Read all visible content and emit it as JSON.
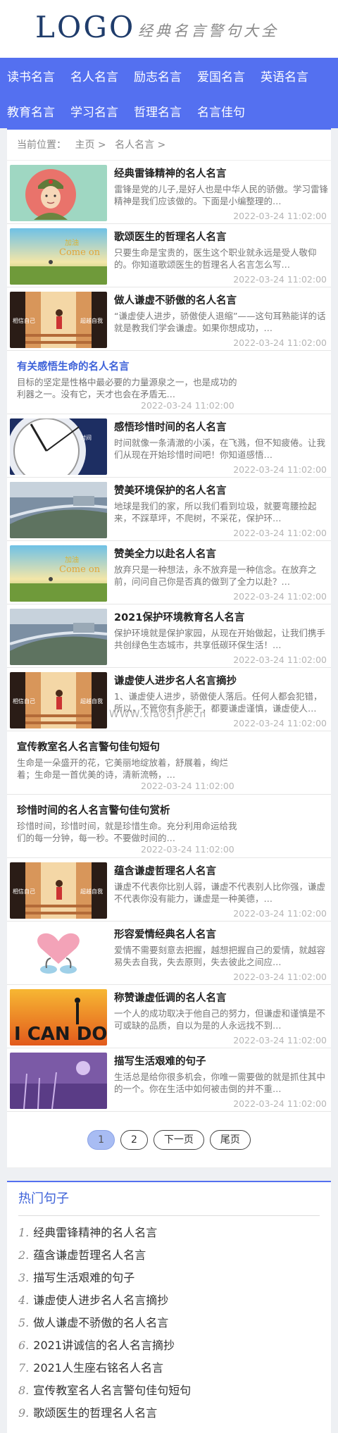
{
  "header": {
    "logo": "LOGO",
    "slogan": "经典名言警句大全"
  },
  "nav": {
    "row1": [
      "读书名言",
      "名人名言",
      "励志名言",
      "爱国名言",
      "英语名言"
    ],
    "row2": [
      "教育名言",
      "学习名言",
      "哲理名言",
      "名言佳句"
    ]
  },
  "breadcrumb": {
    "label": "当前位置：",
    "home": "主页 >",
    "section": "名人名言 >"
  },
  "items": [
    {
      "type": "img",
      "thumb": "soldier",
      "title": "经典雷锋精神的名人名言",
      "desc": "雷锋是党的儿子,是好人也是中华人民的骄傲。学习雷锋精神是我们应该做的。下面是小编整理的…",
      "time": "2022-03-24 11:02:00"
    },
    {
      "type": "img",
      "thumb": "field",
      "title": "歌颂医生的哲理名人名言",
      "desc": "只要生命是宝贵的，医生这个职业就永远是受人敬仰的。你知道歌颂医生的哲理名人名言怎么写…",
      "time": "2022-03-24 11:02:00"
    },
    {
      "type": "img",
      "thumb": "stairs",
      "title": "做人谦虚不骄傲的名人名言",
      "desc": "“谦虚使人进步，骄傲使人退缩”——这句耳熟能详的话就是教我们学会谦虚。如果你想成功，…",
      "time": "2022-03-24 11:02:00"
    },
    {
      "type": "text",
      "blue": true,
      "title": "有关感悟生命的名人名言",
      "desc": "目标的坚定是性格中最必要的力量源泉之一，也是成功的利器之一。没有它，天才也会在矛盾无…",
      "time": "2022-03-24 11:02:00"
    },
    {
      "type": "img",
      "thumb": "clock",
      "title": "感悟珍惜时间的名人名言",
      "desc": "时间就像一条清澈的小溪，在飞溅，但不知疲倦。让我们从现在开始珍惜时间吧！你知道感悟…",
      "time": "2022-03-24 11:02:00"
    },
    {
      "type": "img",
      "thumb": "aerial",
      "title": "赞美环境保护的名人名言",
      "desc": "地球是我们的家，所以我们看到垃圾，就要弯腰捡起来，不踩草坪，不爬树，不采花，保护环…",
      "time": "2022-03-24 11:02:00"
    },
    {
      "type": "img",
      "thumb": "field",
      "title": "赞美全力以赴名人名言",
      "desc": "放弃只是一种想法，永不放弃是一种信念。在放弃之前，问问自己你是否真的做到了全力以赴？…",
      "time": "2022-03-24 11:02:00"
    },
    {
      "type": "img",
      "thumb": "aerial",
      "title": "2021保护环境教育名人名言",
      "desc": "保护环境就是保护家园，从现在开始做起，让我们携手共创绿色生态城市，共享低碳环保生活！…",
      "time": "2022-03-24 11:02:00"
    },
    {
      "type": "img",
      "thumb": "stairs",
      "title": "谦虚使人进步名人名言摘抄",
      "desc": "1、谦虚使人进步，骄傲使人落后。任何人都会犯错，所以，不管你有多能干，都要谦虚谨慎，谦虚使人…",
      "time": "2022-03-24 11:02:00"
    },
    {
      "type": "text",
      "blue": false,
      "title": "宣传教室名人名言警句佳句短句",
      "desc": "生命是一朵盛开的花，它美丽地绽放着，舒展着，绚烂着；生命是一首优美的诗，清新流畅，…",
      "time": "2022-03-24 11:02:00"
    },
    {
      "type": "text",
      "blue": false,
      "title": "珍惜时间的名人名言警句佳句赏析",
      "desc": "珍惜时间，珍惜时间，就是珍惜生命。充分利用命运给我们的每一分钟，每一秒。不要做时间的…",
      "time": "2022-03-24 11:02:00"
    },
    {
      "type": "img",
      "thumb": "stairs",
      "title": "蕴含谦虚哲理名人名言",
      "desc": "谦虚不代表你比别人弱，谦虚不代表别人比你强，谦虚不代表你没有能力，谦虚是一种美德，…",
      "time": "2022-03-24 11:02:00"
    },
    {
      "type": "img",
      "thumb": "swans",
      "title": "形容爱情经典名人名言",
      "desc": "爱情不需要刻意去把握，越想把握自己的爱情，就越容易失去自我，失去原则，失去彼此之间应…",
      "time": "2022-03-24 11:02:00"
    },
    {
      "type": "img",
      "thumb": "icando",
      "title": "称赞谦虚低调的名人名言",
      "desc": "一个人的成功取决于他自己的努力，但谦虚和谨慎是不可或缺的品质，自以为是的人永远找不到…",
      "time": "2022-03-24 11:02:00"
    },
    {
      "type": "img",
      "thumb": "purple",
      "title": "描写生活艰难的句子",
      "desc": "生活总是给你很多机会，你唯一需要做的就是抓住其中的一个。你在生活中如何被击倒的并不重…",
      "time": "2022-03-24 11:02:00"
    }
  ],
  "pager": {
    "p1": "1",
    "p2": "2",
    "next": "下一页",
    "last": "尾页"
  },
  "hot": {
    "title": "热门句子",
    "items": [
      {
        "n": "1.",
        "text": "经典雷锋精神的名人名言"
      },
      {
        "n": "2.",
        "text": "蕴含谦虚哲理名人名言"
      },
      {
        "n": "3.",
        "text": "描写生活艰难的句子"
      },
      {
        "n": "4.",
        "text": "谦虚使人进步名人名言摘抄"
      },
      {
        "n": "5.",
        "text": "做人谦虚不骄傲的名人名言"
      },
      {
        "n": "6.",
        "text": "2021讲诚信的名人名言摘抄"
      },
      {
        "n": "7.",
        "text": "2021人生座右铭名人名言"
      },
      {
        "n": "8.",
        "text": "宣传教室名人名言警句佳句短句"
      },
      {
        "n": "9.",
        "text": "歌颂医生的哲理名人名言"
      }
    ]
  },
  "watermark": "WWW.xiaosijie.cn",
  "colors": {
    "accent": "#5470f0",
    "link_blue": "#3f63d9"
  }
}
